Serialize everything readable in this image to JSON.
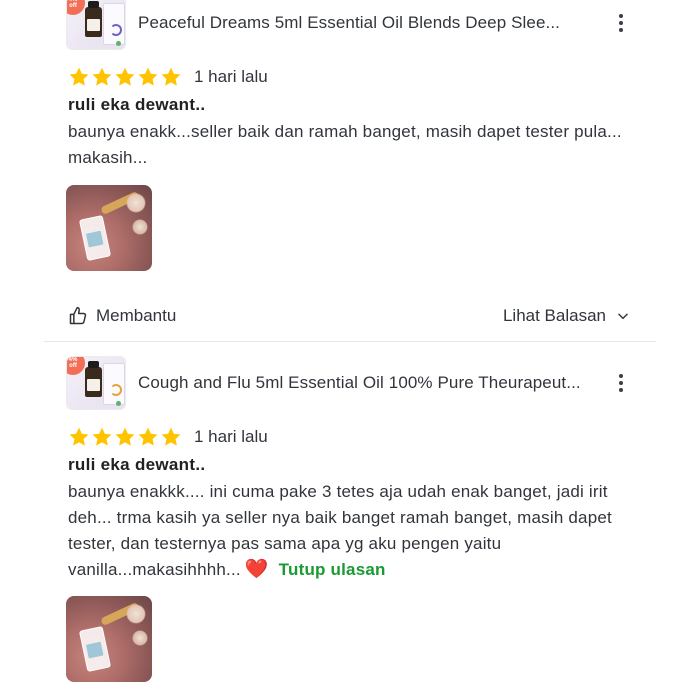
{
  "reviews": [
    {
      "product_name": "Peaceful Dreams 5ml Essential Oil Blends Deep Slee...",
      "thumb_badge": "4%\noff",
      "rating": 5,
      "date": "1 hari lalu",
      "reviewer": "ruli eka dewant..",
      "text": "baunya enakk...seller baik dan ramah banget, masih dapet tester pula... makasih...",
      "has_photo": true
    },
    {
      "product_name": "Cough and Flu 5ml Essential Oil 100% Pure Theurapeut...",
      "thumb_badge": "4%\noff",
      "rating": 5,
      "date": "1 hari lalu",
      "reviewer": "ruli eka dewant..",
      "text": "baunya enakkk.... ini cuma pake 3 tetes aja udah enak banget, jadi irit deh... trma kasih ya seller nya baik banget ramah banget, masih dapet tester, dan testernya pas sama apa yg aku pengen yaitu vanilla...makasihhhh...",
      "heart": "❤️",
      "collapse_label": "Tutup ulasan",
      "has_photo": true
    }
  ],
  "actions": {
    "helpful_label": "Membantu",
    "replies_label": "Lihat Balasan"
  },
  "colors": {
    "star": "#FFC400",
    "link_green": "#1A9A32",
    "text": "#31353B",
    "divider": "#E5E7E9"
  },
  "icons": {
    "kebab": "more-vertical-icon",
    "helpful": "thumbs-up-icon",
    "replies": "chevron-down-icon",
    "star": "star-icon"
  }
}
